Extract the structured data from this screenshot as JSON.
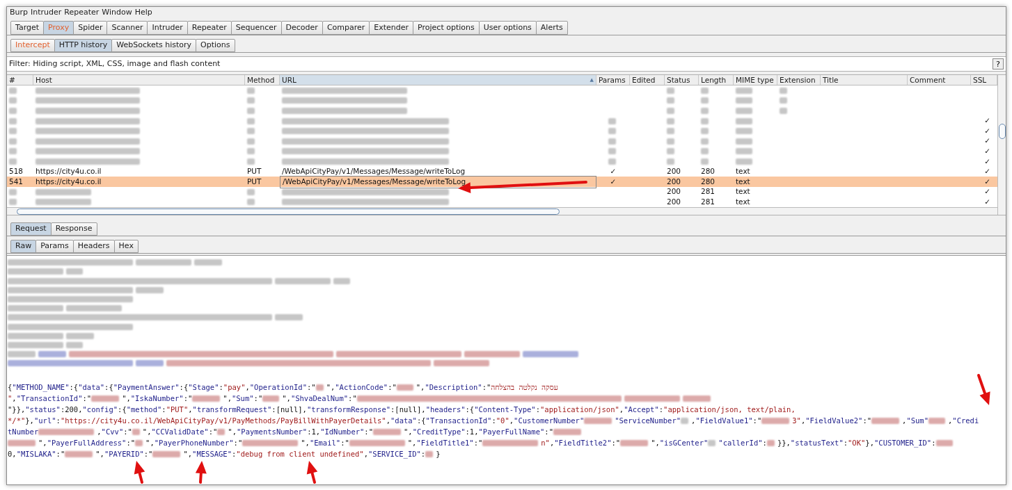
{
  "menu": [
    "Burp",
    "Intruder",
    "Repeater",
    "Window",
    "Help"
  ],
  "tabs": [
    {
      "label": "Target",
      "selected": false,
      "highlighted": false
    },
    {
      "label": "Proxy",
      "selected": true,
      "highlighted": true
    },
    {
      "label": "Spider",
      "selected": false,
      "highlighted": false
    },
    {
      "label": "Scanner",
      "selected": false,
      "highlighted": false
    },
    {
      "label": "Intruder",
      "selected": false,
      "highlighted": false
    },
    {
      "label": "Repeater",
      "selected": false,
      "highlighted": false
    },
    {
      "label": "Sequencer",
      "selected": false,
      "highlighted": false
    },
    {
      "label": "Decoder",
      "selected": false,
      "highlighted": false
    },
    {
      "label": "Comparer",
      "selected": false,
      "highlighted": false
    },
    {
      "label": "Extender",
      "selected": false,
      "highlighted": false
    },
    {
      "label": "Project options",
      "selected": false,
      "highlighted": false
    },
    {
      "label": "User options",
      "selected": false,
      "highlighted": false
    },
    {
      "label": "Alerts",
      "selected": false,
      "highlighted": false
    }
  ],
  "proxy_tabs": [
    {
      "label": "Intercept",
      "selected": false,
      "highlighted": true
    },
    {
      "label": "HTTP history",
      "selected": true,
      "highlighted": false
    },
    {
      "label": "WebSockets history",
      "selected": false,
      "highlighted": false
    },
    {
      "label": "Options",
      "selected": false,
      "highlighted": false
    }
  ],
  "filter": {
    "text": "Filter: Hiding script, XML, CSS, image and flash content",
    "help": "?"
  },
  "table": {
    "columns": [
      {
        "label": "#",
        "sorted": false
      },
      {
        "label": "Host",
        "sorted": false
      },
      {
        "label": "Method",
        "sorted": false
      },
      {
        "label": "URL",
        "sorted": true,
        "sort_indicator": "▲"
      },
      {
        "label": "Params",
        "sorted": false
      },
      {
        "label": "Edited",
        "sorted": false
      },
      {
        "label": "Status",
        "sorted": false
      },
      {
        "label": "Length",
        "sorted": false
      },
      {
        "label": "MIME type",
        "sorted": false
      },
      {
        "label": "Extension",
        "sorted": false
      },
      {
        "label": "Title",
        "sorted": false
      },
      {
        "label": "Comment",
        "sorted": false
      },
      {
        "label": "SSL",
        "sorted": false
      }
    ],
    "rows": [
      {
        "selected": false,
        "cells": [
          {
            "kind": "tiny"
          },
          {
            "kind": "broad"
          },
          {
            "kind": "tiny"
          },
          {
            "kind": "wide"
          },
          {
            "kind": "empty"
          },
          {
            "kind": "empty"
          },
          {
            "kind": "tiny"
          },
          {
            "kind": "tiny"
          },
          {
            "kind": "short"
          },
          {
            "kind": "tiny"
          },
          {
            "kind": "empty"
          },
          {
            "kind": "empty"
          },
          {
            "kind": "empty"
          }
        ]
      },
      {
        "selected": false,
        "cells": [
          {
            "kind": "tiny"
          },
          {
            "kind": "broad"
          },
          {
            "kind": "tiny"
          },
          {
            "kind": "wide"
          },
          {
            "kind": "empty"
          },
          {
            "kind": "empty"
          },
          {
            "kind": "tiny"
          },
          {
            "kind": "tiny"
          },
          {
            "kind": "short"
          },
          {
            "kind": "tiny"
          },
          {
            "kind": "empty"
          },
          {
            "kind": "empty"
          },
          {
            "kind": "empty"
          }
        ]
      },
      {
        "selected": false,
        "cells": [
          {
            "kind": "tiny"
          },
          {
            "kind": "broad"
          },
          {
            "kind": "tiny"
          },
          {
            "kind": "wide"
          },
          {
            "kind": "empty"
          },
          {
            "kind": "empty"
          },
          {
            "kind": "tiny"
          },
          {
            "kind": "tiny"
          },
          {
            "kind": "short"
          },
          {
            "kind": "tiny"
          },
          {
            "kind": "empty"
          },
          {
            "kind": "empty"
          },
          {
            "kind": "empty"
          }
        ]
      },
      {
        "selected": false,
        "cells": [
          {
            "kind": "tiny"
          },
          {
            "kind": "broad"
          },
          {
            "kind": "tiny"
          },
          {
            "kind": "huge"
          },
          {
            "kind": "tiny"
          },
          {
            "kind": "empty"
          },
          {
            "kind": "tiny"
          },
          {
            "kind": "tiny"
          },
          {
            "kind": "short"
          },
          {
            "kind": "empty"
          },
          {
            "kind": "empty"
          },
          {
            "kind": "empty"
          },
          {
            "kind": "text",
            "text": "✓"
          }
        ]
      },
      {
        "selected": false,
        "cells": [
          {
            "kind": "tiny"
          },
          {
            "kind": "broad"
          },
          {
            "kind": "tiny"
          },
          {
            "kind": "huge"
          },
          {
            "kind": "tiny"
          },
          {
            "kind": "empty"
          },
          {
            "kind": "tiny"
          },
          {
            "kind": "tiny"
          },
          {
            "kind": "short"
          },
          {
            "kind": "empty"
          },
          {
            "kind": "empty"
          },
          {
            "kind": "empty"
          },
          {
            "kind": "text",
            "text": "✓"
          }
        ]
      },
      {
        "selected": false,
        "cells": [
          {
            "kind": "tiny"
          },
          {
            "kind": "broad"
          },
          {
            "kind": "tiny"
          },
          {
            "kind": "huge"
          },
          {
            "kind": "tiny"
          },
          {
            "kind": "empty"
          },
          {
            "kind": "tiny"
          },
          {
            "kind": "tiny"
          },
          {
            "kind": "short"
          },
          {
            "kind": "empty"
          },
          {
            "kind": "empty"
          },
          {
            "kind": "empty"
          },
          {
            "kind": "text",
            "text": "✓"
          }
        ]
      },
      {
        "selected": false,
        "cells": [
          {
            "kind": "tiny"
          },
          {
            "kind": "broad"
          },
          {
            "kind": "tiny"
          },
          {
            "kind": "huge"
          },
          {
            "kind": "tiny"
          },
          {
            "kind": "empty"
          },
          {
            "kind": "tiny"
          },
          {
            "kind": "tiny"
          },
          {
            "kind": "short"
          },
          {
            "kind": "empty"
          },
          {
            "kind": "empty"
          },
          {
            "kind": "empty"
          },
          {
            "kind": "text",
            "text": "✓"
          }
        ]
      },
      {
        "selected": false,
        "cells": [
          {
            "kind": "tiny"
          },
          {
            "kind": "broad"
          },
          {
            "kind": "tiny"
          },
          {
            "kind": "huge"
          },
          {
            "kind": "tiny"
          },
          {
            "kind": "empty"
          },
          {
            "kind": "tiny"
          },
          {
            "kind": "tiny"
          },
          {
            "kind": "short"
          },
          {
            "kind": "empty"
          },
          {
            "kind": "empty"
          },
          {
            "kind": "empty"
          },
          {
            "kind": "text",
            "text": "✓"
          }
        ]
      },
      {
        "selected": false,
        "cells": [
          {
            "kind": "text",
            "text": "518"
          },
          {
            "kind": "text",
            "text": "https://city4u.co.il"
          },
          {
            "kind": "text",
            "text": "PUT"
          },
          {
            "kind": "text",
            "text": "/WebApiCityPay/v1/Messages/Message/writeToLog"
          },
          {
            "kind": "text",
            "text": "✓"
          },
          {
            "kind": "empty"
          },
          {
            "kind": "text",
            "text": "200"
          },
          {
            "kind": "text",
            "text": "280"
          },
          {
            "kind": "text",
            "text": "text"
          },
          {
            "kind": "empty"
          },
          {
            "kind": "empty"
          },
          {
            "kind": "empty"
          },
          {
            "kind": "text",
            "text": "✓"
          }
        ]
      },
      {
        "selected": true,
        "cells": [
          {
            "kind": "text",
            "text": "541"
          },
          {
            "kind": "text",
            "text": "https://city4u.co.il"
          },
          {
            "kind": "text",
            "text": "PUT"
          },
          {
            "kind": "text",
            "text": "/WebApiCityPay/v1/Messages/Message/writeToLog"
          },
          {
            "kind": "text",
            "text": "✓"
          },
          {
            "kind": "empty"
          },
          {
            "kind": "text",
            "text": "200"
          },
          {
            "kind": "text",
            "text": "280"
          },
          {
            "kind": "text",
            "text": "text"
          },
          {
            "kind": "empty"
          },
          {
            "kind": "empty"
          },
          {
            "kind": "empty"
          },
          {
            "kind": "text",
            "text": "✓"
          }
        ]
      },
      {
        "selected": false,
        "cells": [
          {
            "kind": "tiny"
          },
          {
            "kind": "long"
          },
          {
            "kind": "tiny"
          },
          {
            "kind": "huge"
          },
          {
            "kind": "empty"
          },
          {
            "kind": "empty"
          },
          {
            "kind": "text",
            "text": "200"
          },
          {
            "kind": "text",
            "text": "281"
          },
          {
            "kind": "text",
            "text": "text"
          },
          {
            "kind": "empty"
          },
          {
            "kind": "empty"
          },
          {
            "kind": "empty"
          },
          {
            "kind": "text",
            "text": "✓"
          }
        ]
      },
      {
        "selected": false,
        "cells": [
          {
            "kind": "tiny"
          },
          {
            "kind": "long"
          },
          {
            "kind": "tiny"
          },
          {
            "kind": "huge"
          },
          {
            "kind": "empty"
          },
          {
            "kind": "empty"
          },
          {
            "kind": "text",
            "text": "200"
          },
          {
            "kind": "text",
            "text": "281"
          },
          {
            "kind": "text",
            "text": "text"
          },
          {
            "kind": "empty"
          },
          {
            "kind": "empty"
          },
          {
            "kind": "empty"
          },
          {
            "kind": "text",
            "text": "✓"
          }
        ]
      }
    ]
  },
  "message_tabs": [
    {
      "label": "Request",
      "selected": true
    },
    {
      "label": "Response",
      "selected": false
    }
  ],
  "view_tabs": [
    {
      "label": "Raw",
      "selected": true
    },
    {
      "label": "Params",
      "selected": false
    },
    {
      "label": "Headers",
      "selected": false
    },
    {
      "label": "Hex",
      "selected": false
    }
  ],
  "redacted_lines": [
    {
      "segments": [
        {
          "kind": "wide",
          "color": "#c6c6c6"
        },
        {
          "kind": "long",
          "color": "#c6c6c6"
        },
        {
          "kind": "medium",
          "color": "#c6c6c6"
        }
      ]
    },
    {
      "segments": [
        {
          "kind": "long",
          "color": "#c6c6c6"
        },
        {
          "kind": "short",
          "color": "#c6c6c6"
        }
      ]
    },
    {
      "segments": [
        {
          "kind": "huge",
          "color": "#c6c6c6"
        },
        {
          "kind": "long",
          "color": "#c6c6c6"
        },
        {
          "kind": "short",
          "color": "#c6c6c6"
        }
      ]
    },
    {
      "segments": [
        {
          "kind": "wide",
          "color": "#c6c6c6"
        },
        {
          "kind": "medium",
          "color": "#c6c6c6"
        }
      ]
    },
    {
      "segments": [
        {
          "kind": "wide",
          "color": "#c6c6c6"
        }
      ]
    },
    {
      "segments": [
        {
          "kind": "long",
          "color": "#c6c6c6"
        },
        {
          "kind": "long",
          "color": "#c6c6c6"
        }
      ]
    },
    {
      "segments": [
        {
          "kind": "huge",
          "color": "#c6c6c6"
        },
        {
          "kind": "medium",
          "color": "#c6c6c6"
        }
      ]
    },
    {
      "segments": [
        {
          "kind": "wide",
          "color": "#c6c6c6"
        }
      ]
    },
    {
      "segments": [
        {
          "kind": "long",
          "color": "#c6c6c6"
        },
        {
          "kind": "medium",
          "color": "#c6c6c6"
        }
      ]
    },
    {
      "segments": [
        {
          "kind": "long",
          "color": "#c6c6c6"
        },
        {
          "kind": "short",
          "color": "#c6c6c6"
        }
      ]
    },
    {
      "segments": [
        {
          "kind": "medium",
          "color": "#c6c6c6"
        },
        {
          "kind": "medium",
          "color": "#aab0dc"
        },
        {
          "kind": "huge",
          "color": "#dcaaaa"
        },
        {
          "kind": "wide",
          "color": "#dcaaaa"
        },
        {
          "kind": "long",
          "color": "#dcaaaa"
        },
        {
          "kind": "long",
          "color": "#aab0dc"
        }
      ]
    },
    {
      "segments": [
        {
          "kind": "wide",
          "color": "#aab0dc"
        },
        {
          "kind": "medium",
          "color": "#aab0dc"
        },
        {
          "kind": "huge",
          "color": "#dcaaaa"
        },
        {
          "kind": "long",
          "color": "#dcaaaa"
        }
      ]
    }
  ],
  "json_lines": [
    {
      "segments": [
        {
          "kind": "punct",
          "text": "{"
        },
        {
          "kind": "key",
          "text": "\"METHOD_NAME\""
        },
        {
          "kind": "punct",
          "text": ":{"
        },
        {
          "kind": "key",
          "text": "\"data\""
        },
        {
          "kind": "punct",
          "text": ":{"
        },
        {
          "kind": "key",
          "text": "\"PaymentAnswer\""
        },
        {
          "kind": "punct",
          "text": ":{"
        },
        {
          "kind": "key",
          "text": "\"Stage\""
        },
        {
          "kind": "punct",
          "text": ":"
        },
        {
          "kind": "string",
          "text": "\"pay\""
        },
        {
          "kind": "punct",
          "text": ","
        },
        {
          "kind": "key",
          "text": "\"OperationId\""
        },
        {
          "kind": "punct",
          "text": ":\""
        },
        {
          "kind": "tiny",
          "color": "#dcaaaa"
        },
        {
          "kind": "punct",
          "text": "\","
        },
        {
          "kind": "key",
          "text": "\"ActionCode\""
        },
        {
          "kind": "punct",
          "text": ":\""
        },
        {
          "kind": "short",
          "color": "#dcaaaa"
        },
        {
          "kind": "punct",
          "text": "\","
        },
        {
          "kind": "key",
          "text": "\"Description\""
        },
        {
          "kind": "punct",
          "text": ":\""
        },
        {
          "kind": "string",
          "text": "עסקה נקלטה בהצלחה"
        }
      ]
    },
    {
      "segments": [
        {
          "kind": "string",
          "text": "\""
        },
        {
          "kind": "punct",
          "text": ","
        },
        {
          "kind": "key",
          "text": "\"TransactionId\""
        },
        {
          "kind": "punct",
          "text": ":\""
        },
        {
          "kind": "medium",
          "color": "#dcaaaa"
        },
        {
          "kind": "punct",
          "text": "\","
        },
        {
          "kind": "key",
          "text": "\"IskaNumber\""
        },
        {
          "kind": "punct",
          "text": ":\""
        },
        {
          "kind": "medium",
          "color": "#dcaaaa"
        },
        {
          "kind": "punct",
          "text": "\","
        },
        {
          "kind": "key",
          "text": "\"Sum\""
        },
        {
          "kind": "punct",
          "text": ":\""
        },
        {
          "kind": "short",
          "color": "#dcaaaa"
        },
        {
          "kind": "punct",
          "text": "\","
        },
        {
          "kind": "key",
          "text": "\"ShvaDealNum\""
        },
        {
          "kind": "punct",
          "text": ":\""
        },
        {
          "kind": "huge",
          "color": "#dcaaaa"
        },
        {
          "kind": "long",
          "color": "#dcaaaa"
        },
        {
          "kind": "medium",
          "color": "#dcaaaa"
        }
      ]
    },
    {
      "segments": [
        {
          "kind": "punct",
          "text": "\"}},"
        },
        {
          "kind": "key",
          "text": "\"status\""
        },
        {
          "kind": "punct",
          "text": ":200,"
        },
        {
          "kind": "key",
          "text": "\"config\""
        },
        {
          "kind": "punct",
          "text": ":{"
        },
        {
          "kind": "key",
          "text": "\"method\""
        },
        {
          "kind": "punct",
          "text": ":"
        },
        {
          "kind": "string",
          "text": "\"PUT\""
        },
        {
          "kind": "punct",
          "text": ","
        },
        {
          "kind": "key",
          "text": "\"transformRequest\""
        },
        {
          "kind": "punct",
          "text": ":[null],"
        },
        {
          "kind": "key",
          "text": "\"transformResponse\""
        },
        {
          "kind": "punct",
          "text": ":[null],"
        },
        {
          "kind": "key",
          "text": "\"headers\""
        },
        {
          "kind": "punct",
          "text": ":{"
        },
        {
          "kind": "key",
          "text": "\"Content-Type\""
        },
        {
          "kind": "punct",
          "text": ":"
        },
        {
          "kind": "string",
          "text": "\"application/json\""
        },
        {
          "kind": "punct",
          "text": ","
        },
        {
          "kind": "key",
          "text": "\"Accept\""
        },
        {
          "kind": "punct",
          "text": ":"
        },
        {
          "kind": "string",
          "text": "\"application/json, text/plain,"
        }
      ]
    },
    {
      "segments": [
        {
          "kind": "string",
          "text": "*/*\""
        },
        {
          "kind": "punct",
          "text": "},"
        },
        {
          "kind": "key",
          "text": "\"url\""
        },
        {
          "kind": "punct",
          "text": ":"
        },
        {
          "kind": "string",
          "text": "\"https://city4u.co.il/WebApiCityPay/v1/PayMethods/PayBillWithPayerDetails\""
        },
        {
          "kind": "punct",
          "text": ","
        },
        {
          "kind": "key",
          "text": "\"data\""
        },
        {
          "kind": "punct",
          "text": ":{"
        },
        {
          "kind": "key",
          "text": "\"TransactionId\""
        },
        {
          "kind": "punct",
          "text": ":"
        },
        {
          "kind": "string",
          "text": "\"0\""
        },
        {
          "kind": "punct",
          "text": ","
        },
        {
          "kind": "key",
          "text": "\"CustomerNumber\""
        },
        {
          "kind": "medium",
          "color": "#dcaaaa"
        },
        {
          "kind": "key",
          "text": "\"ServiceNumber\""
        },
        {
          "kind": "tiny",
          "color": "#c6c6c6"
        },
        {
          "kind": "punct",
          "text": ","
        },
        {
          "kind": "key",
          "text": "\"FieldValue1\""
        },
        {
          "kind": "punct",
          "text": ":\""
        },
        {
          "kind": "medium",
          "color": "#dcaaaa"
        },
        {
          "kind": "string",
          "text": "3\""
        },
        {
          "kind": "punct",
          "text": ","
        },
        {
          "kind": "key",
          "text": "\"FieldValue2\""
        },
        {
          "kind": "punct",
          "text": ":\""
        },
        {
          "kind": "medium",
          "color": "#dcaaaa"
        },
        {
          "kind": "punct",
          "text": ","
        },
        {
          "kind": "key",
          "text": "\"Sum\""
        },
        {
          "kind": "short",
          "color": "#dcaaaa"
        },
        {
          "kind": "punct",
          "text": ","
        },
        {
          "kind": "key",
          "text": "\"Credi"
        }
      ]
    },
    {
      "segments": [
        {
          "kind": "key",
          "text": "tNumber"
        },
        {
          "kind": "long",
          "color": "#dcaaaa"
        },
        {
          "kind": "punct",
          "text": ","
        },
        {
          "kind": "key",
          "text": "\"Cvv\""
        },
        {
          "kind": "punct",
          "text": ":\""
        },
        {
          "kind": "tiny",
          "color": "#dcaaaa"
        },
        {
          "kind": "punct",
          "text": "\","
        },
        {
          "kind": "key",
          "text": "\"CCValidDate\""
        },
        {
          "kind": "punct",
          "text": ":\""
        },
        {
          "kind": "tiny",
          "color": "#dcaaaa"
        },
        {
          "kind": "punct",
          "text": "\","
        },
        {
          "kind": "key",
          "text": "\"PaymentsNumber\""
        },
        {
          "kind": "punct",
          "text": ":1,"
        },
        {
          "kind": "key",
          "text": "\"IdNumber\""
        },
        {
          "kind": "punct",
          "text": ":\""
        },
        {
          "kind": "medium",
          "color": "#dcaaaa"
        },
        {
          "kind": "punct",
          "text": "\","
        },
        {
          "kind": "key",
          "text": "\"CreditType\""
        },
        {
          "kind": "punct",
          "text": ":1,"
        },
        {
          "kind": "key",
          "text": "\"PayerFullName\""
        },
        {
          "kind": "punct",
          "text": ":\""
        },
        {
          "kind": "medium",
          "color": "#dcaaaa"
        }
      ]
    },
    {
      "segments": [
        {
          "kind": "medium",
          "color": "#dcaaaa"
        },
        {
          "kind": "punct",
          "text": "\","
        },
        {
          "kind": "key",
          "text": "\"PayerFullAddress\""
        },
        {
          "kind": "punct",
          "text": ":\""
        },
        {
          "kind": "tiny",
          "color": "#dcaaaa"
        },
        {
          "kind": "punct",
          "text": "\","
        },
        {
          "kind": "key",
          "text": "\"PayerPhoneNumber\""
        },
        {
          "kind": "punct",
          "text": ":\""
        },
        {
          "kind": "long",
          "color": "#dcaaaa"
        },
        {
          "kind": "punct",
          "text": "\","
        },
        {
          "kind": "key",
          "text": "\"Email\""
        },
        {
          "kind": "punct",
          "text": ":\""
        },
        {
          "kind": "long",
          "color": "#dcaaaa"
        },
        {
          "kind": "punct",
          "text": "\","
        },
        {
          "kind": "key",
          "text": "\"FieldTitle1\""
        },
        {
          "kind": "punct",
          "text": ":\""
        },
        {
          "kind": "long",
          "color": "#dcaaaa"
        },
        {
          "kind": "string",
          "text": "n\""
        },
        {
          "kind": "punct",
          "text": ","
        },
        {
          "kind": "key",
          "text": "\"FieldTitle2\""
        },
        {
          "kind": "punct",
          "text": ":\""
        },
        {
          "kind": "medium",
          "color": "#dcaaaa"
        },
        {
          "kind": "punct",
          "text": "\","
        },
        {
          "kind": "key",
          "text": "\"isGCenter\""
        },
        {
          "kind": "tiny",
          "color": "#c6c6c6"
        },
        {
          "kind": "key",
          "text": "\"callerId\""
        },
        {
          "kind": "punct",
          "text": ":"
        },
        {
          "kind": "tiny",
          "color": "#dcaaaa"
        },
        {
          "kind": "punct",
          "text": "}},"
        },
        {
          "kind": "key",
          "text": "\"statusText\""
        },
        {
          "kind": "punct",
          "text": ":"
        },
        {
          "kind": "string",
          "text": "\"OK\""
        },
        {
          "kind": "punct",
          "text": "},"
        },
        {
          "kind": "key",
          "text": "\"CUSTOMER_ID\""
        },
        {
          "kind": "punct",
          "text": ":"
        },
        {
          "kind": "short",
          "color": "#dcaaaa"
        }
      ]
    },
    {
      "segments": [
        {
          "kind": "punct",
          "text": "0,"
        },
        {
          "kind": "key",
          "text": "\"MISLAKA\""
        },
        {
          "kind": "punct",
          "text": ":\""
        },
        {
          "kind": "medium",
          "color": "#dcaaaa"
        },
        {
          "kind": "punct",
          "text": "\","
        },
        {
          "kind": "key",
          "text": "\"PAYERID\""
        },
        {
          "kind": "punct",
          "text": ":\""
        },
        {
          "kind": "medium",
          "color": "#dcaaaa"
        },
        {
          "kind": "punct",
          "text": "\","
        },
        {
          "kind": "key",
          "text": "\"MESSAGE\""
        },
        {
          "kind": "punct",
          "text": ":"
        },
        {
          "kind": "string",
          "text": "\"debug from client undefined\""
        },
        {
          "kind": "punct",
          "text": ","
        },
        {
          "kind": "key",
          "text": "\"SERVICE_ID\""
        },
        {
          "kind": "punct",
          "text": ":"
        },
        {
          "kind": "tiny",
          "color": "#dcaaaa"
        },
        {
          "kind": "punct",
          "text": "}"
        }
      ]
    }
  ]
}
